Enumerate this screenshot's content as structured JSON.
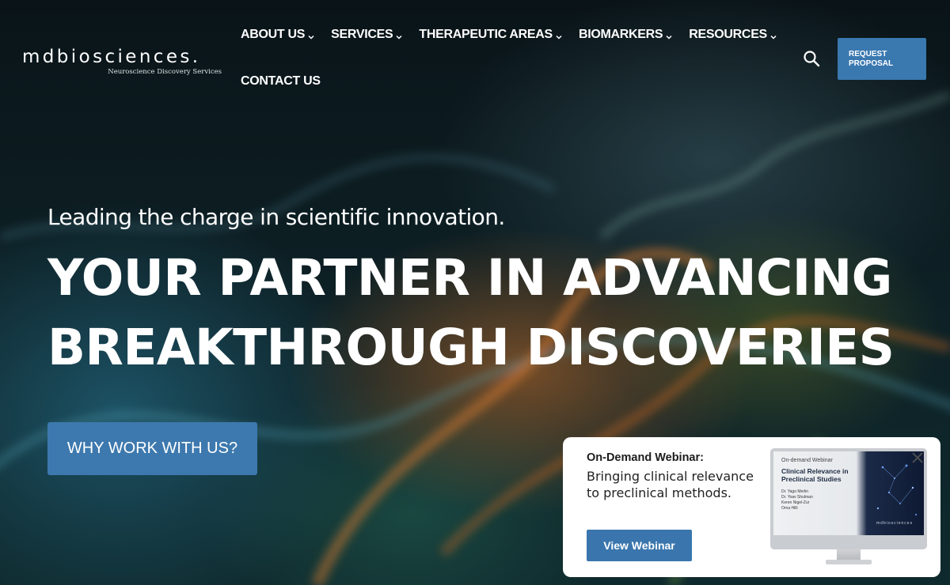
{
  "brand": {
    "logo_word": "mdbiosciences.",
    "tagline": "Neuroscience Discovery Services"
  },
  "nav": {
    "row1": [
      {
        "label": "ABOUT US",
        "has_dropdown": true
      },
      {
        "label": "SERVICES",
        "has_dropdown": true
      },
      {
        "label": "THERAPEUTIC AREAS",
        "has_dropdown": true
      },
      {
        "label": "BIOMARKERS",
        "has_dropdown": true
      },
      {
        "label": "RESOURCES",
        "has_dropdown": true
      }
    ],
    "row2": [
      {
        "label": "CONTACT US",
        "has_dropdown": false
      }
    ]
  },
  "header": {
    "search_icon": "search-icon",
    "request_line1": "REQUEST",
    "request_line2": "PROPOSAL"
  },
  "hero": {
    "subhead": "Leading the charge in scientific innovation.",
    "headline_line1": "YOUR PARTNER IN ADVANCING",
    "headline_line2": "BREAKTHROUGH DISCOVERIES",
    "cta_label": "WHY WORK WITH US?"
  },
  "popup": {
    "kicker": "On-Demand Webinar:",
    "title": "Bringing clinical relevance to preclinical methods.",
    "button_label": "View Webinar",
    "close_icon": "close-icon",
    "screen": {
      "kicker": "On-demand Webinar",
      "title": "Clinical Relevance in Preclinical Studies",
      "names": [
        "Dr. Yago Merlin",
        "Dr. Yoav Shulman",
        "Keren Nigel-Zur",
        "Orna Hilli"
      ],
      "logo": "mdbiosciences"
    }
  },
  "colors": {
    "accent": "#3a78b0",
    "popup_bg": "#ffffff",
    "hero_text": "#ffffff"
  }
}
